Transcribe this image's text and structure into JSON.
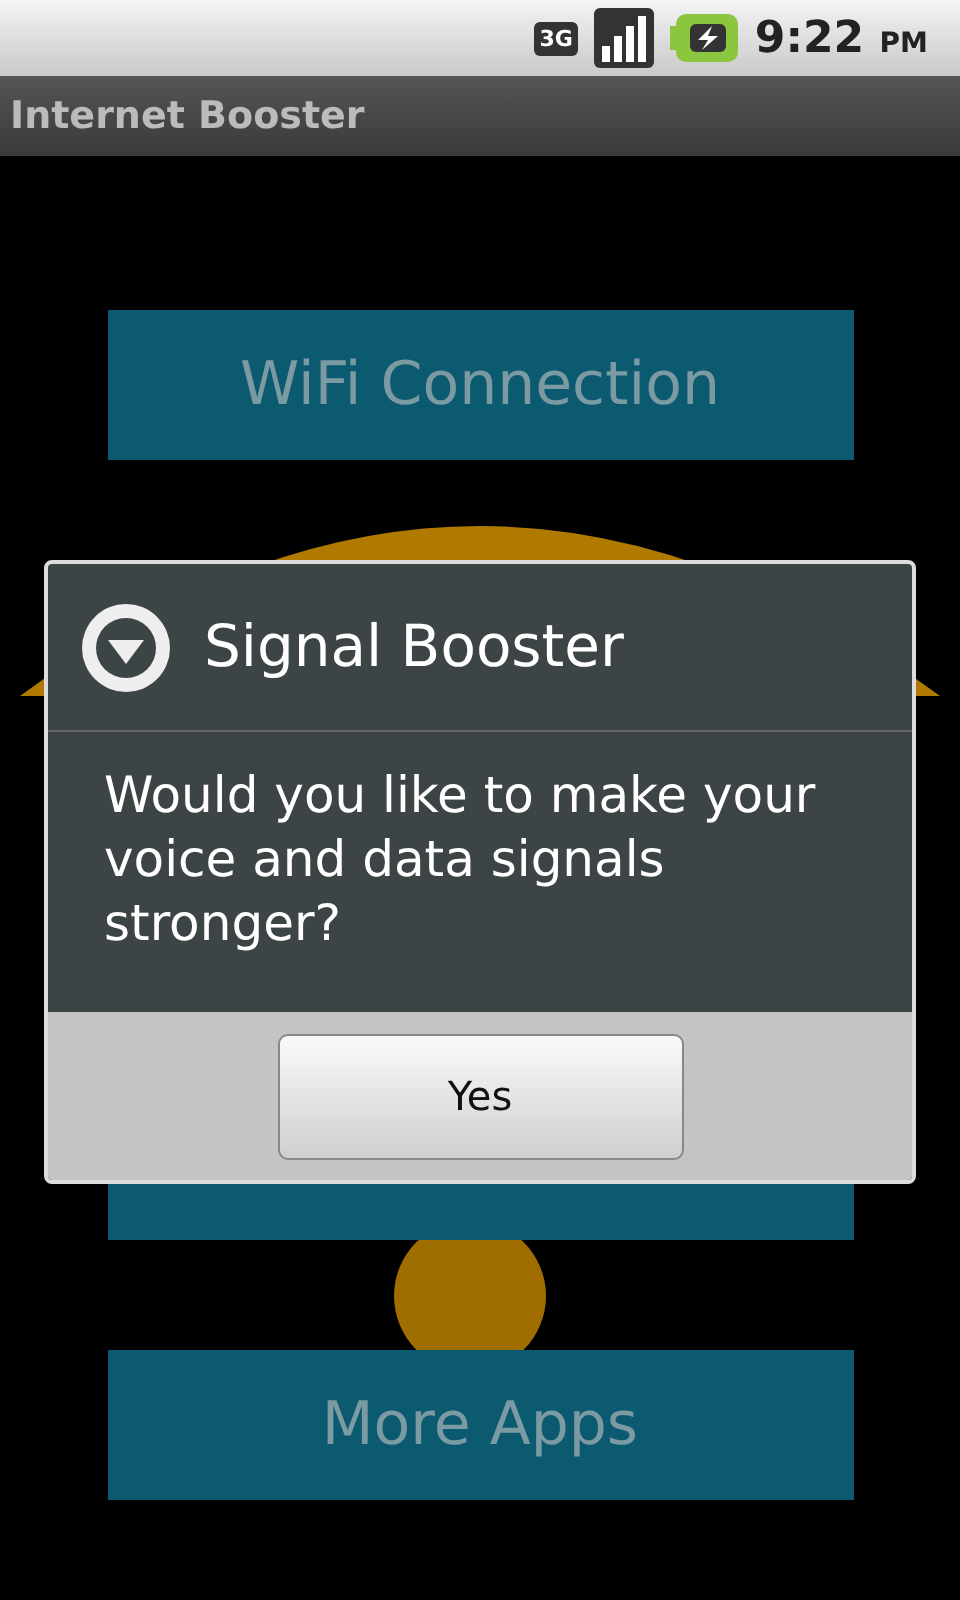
{
  "status_bar": {
    "network": "3G",
    "time": "9:22",
    "meridiem": "PM"
  },
  "title_bar": {
    "title": "Internet Booster"
  },
  "buttons": [
    {
      "kind": "labeled",
      "label": "WiFi Connection"
    },
    {
      "kind": "covered"
    },
    {
      "kind": "labeled",
      "label": "More Apps"
    }
  ],
  "dialog": {
    "title": "Signal Booster",
    "message": "Would you like to make your voice and data signals stronger?",
    "buttons": [
      "Yes"
    ]
  }
}
